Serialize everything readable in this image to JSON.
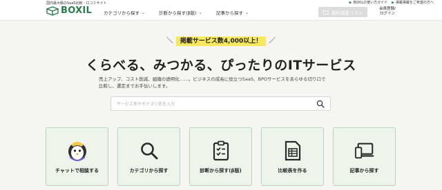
{
  "header": {
    "tagline": "国内最大級のSaaS比較・口コミサイト",
    "logo_text": "BOXIL",
    "nav": [
      {
        "label": "カテゴリから探す",
        "icon": "chevron-down-icon"
      },
      {
        "label": "診断から探す(β版)",
        "icon": "chevron-down-icon"
      },
      {
        "label": "記事から探す",
        "icon": "chevron-down-icon"
      }
    ],
    "top_links": [
      "BOXILの使い方ガイド",
      "掲載掲載をご希望の方へ"
    ],
    "doc_list_button": "資料請求リスト",
    "login_line1": "会員登録/",
    "login_line2": "ログイン"
  },
  "hero": {
    "badge": "掲載サービス数4,000以上！",
    "title": "くらべる、みつかる、ぴったりのITサービス",
    "desc_line1": "売上アップ、コスト削減、組織の透明化……。ビジネスの成長に役立つSaaS、BPOサービスをあらゆる切り口で",
    "desc_line2": "比較し、選定までお手伝いします。"
  },
  "search": {
    "placeholder": "サービス名やカテゴリ名を入力"
  },
  "cards": [
    {
      "label": "チャットで相談する",
      "icon": "penguin-mascot-icon"
    },
    {
      "label": "カテゴリから探す",
      "icon": "search-icon"
    },
    {
      "label": "診断から探す(β版)",
      "icon": "checklist-icon"
    },
    {
      "label": "比較表を作る",
      "icon": "spreadsheet-icon"
    },
    {
      "label": "記事から探す",
      "icon": "devices-icon"
    }
  ],
  "colors": {
    "brand": "#2b7a4b",
    "badge": "#f5e85f",
    "card_bg": "#eef4ec",
    "card_border": "#b8d1bb",
    "page_bg": "#f5f6f3"
  }
}
